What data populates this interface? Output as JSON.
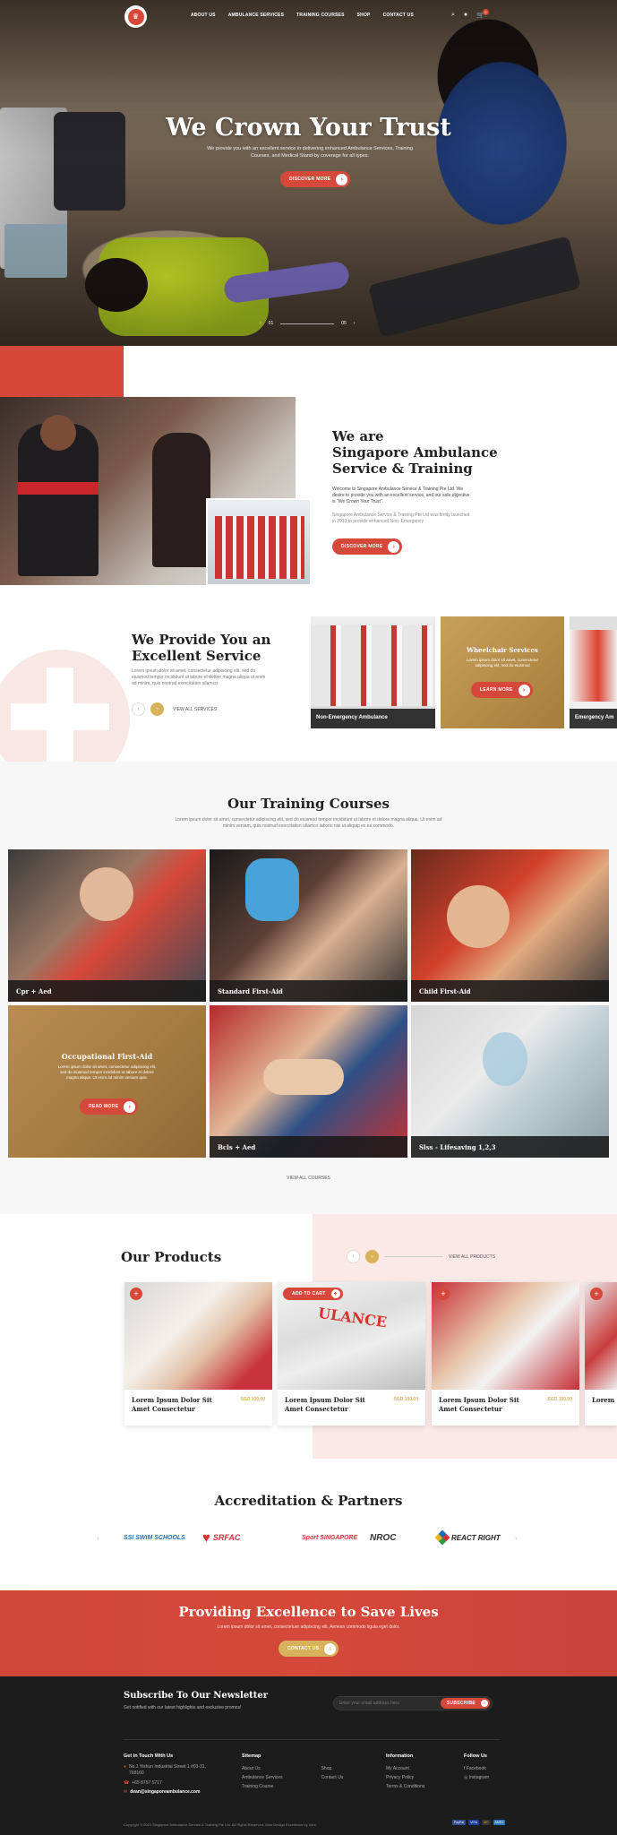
{
  "nav": {
    "items": [
      "ABOUT US",
      "AMBULANCE SERVICES",
      "TRAINING COURSES",
      "SHOP",
      "CONTACT US"
    ],
    "cart_count": "0"
  },
  "hero": {
    "title": "We Crown Your Trust",
    "subtitle": "We provide you with an excellent service in delivering enhanced Ambulance Services, Training Courses, and Medical Stand-by coverage for all types.",
    "button": "DISCOVER MORE",
    "slider": {
      "current": "01",
      "total": "05"
    }
  },
  "about": {
    "title_line1": "We are",
    "title_line2": "Singapore Ambulance",
    "title_line3": "Service & Training",
    "p1": "Welcome to Singapore Ambulance Service & Training Pte Ltd. We desire to provide you with an excellent service, and our sole objective is \"We Crown Your Trust\".",
    "p2": "Singapore Ambulance Service & Training Pte Ltd was firmly launched in 2013 to provide enhanced Non- Emergency",
    "button": "DISCOVER MORE"
  },
  "services": {
    "title_line1": "We Provide You an",
    "title_line2": "Excellent Service",
    "text": "Lorem ipsum dolor sit amet, consectetur adipiscing elit, sed do eiusmod tempor incididunt ut labore et dolore magna aliqua ut enim ad minim, quis nostrud exercitation ullamco",
    "view_all": "VIEW ALL SERVICES",
    "cards": [
      {
        "label": "Non-Emergency Ambulance"
      },
      {
        "label": "Wheelchair Services",
        "text": "Lorem ipsum dolor sit amet, consectetur adipiscing elit, sed do eiusmod",
        "button": "LEARN MORE"
      },
      {
        "label": "Emergency Am"
      }
    ]
  },
  "training": {
    "title": "Our Training Courses",
    "text": "Lorem ipsum dolor sit amet, consectetur adipiscing elit, sed do eiusmod tempor incididunt ut labore et dolore magna aliqua. Ut enim ad minim veniam, quis nostrud exercitation ullamco laboris nisi ut aliquip ex ea commodo.",
    "courses": [
      {
        "label": "Cpr + Aed"
      },
      {
        "label": "Standard First-Aid"
      },
      {
        "label": "Child First-Aid"
      },
      {
        "label": "Occupational First-Aid",
        "text": "Lorem ipsum dolor sit amet, consectetur adipiscing elit, sed do eiusmod tempor incididunt ut labore et dolore magna aliqua. Ut enim ad minim veniam quis.",
        "button": "READ MORE"
      },
      {
        "label": "Bcls + Aed"
      },
      {
        "label": "Slss - Lifesaving 1,2,3"
      }
    ],
    "view_all": "VIEW ALL COURSES"
  },
  "products": {
    "title": "Our Products",
    "view_all": "VIEW ALL PRODUCTS",
    "add_to_cart": "ADD TO CART",
    "items": [
      {
        "title": "Lorem Ipsum Dolor Sit Amet Consectetur",
        "price": "SGD 100.00"
      },
      {
        "title": "Lorem Ipsum Dolor Sit Amet Consectetur",
        "price": "SGD 100.00"
      },
      {
        "title": "Lorem Ipsum Dolor Sit Amet Consectetur",
        "price": "SGD 100.00"
      },
      {
        "title": "Lorem Ipsum Dolor Sit Am",
        "price": ""
      }
    ]
  },
  "partners": {
    "title": "Accreditation & Partners",
    "logos": [
      "SSI SWIM SCHOOLS",
      "SRFAC",
      "Sport SINGAPORE",
      "NROC",
      "REACT RIGHT"
    ]
  },
  "cta": {
    "title": "Providing Excellence to Save Lives",
    "text": "Lorem ipsum dolor sit amet, consectetuer adipiscing elit. Aenean commodo ligula eget dolor.",
    "button": "CONTACT US"
  },
  "newsletter": {
    "title": "Subscribe To Our Newsletter",
    "text": "Get notified with our latest highlights and exclusive promos!",
    "placeholder": "Enter your email address here",
    "button": "SUBSCRIBE"
  },
  "footer": {
    "contact_title": "Get In Touch With Us",
    "address": "No.1 Yishun Industrial Street 1 #03-31, 768160",
    "phone": "+65 8757 5717",
    "email": "dean@singaporeambulance.com",
    "sitemap_title": "Sitemap",
    "sitemap": [
      "About Us",
      "Ambulance Services",
      "Training Course",
      "Shop",
      "Contact Us"
    ],
    "info_title": "Information",
    "info": [
      "My Account",
      "Privacy Policy",
      "Terms & Conditions"
    ],
    "follow_title": "Follow Us",
    "follow": [
      "Facebook",
      "Instagram"
    ],
    "copyright": "Copyright © 2021 Singapore Ambulance Service & Training Pte Ltd. All Rights Reserved. Web Design Excellence by Verz",
    "payments": [
      "PayPal",
      "VISA",
      "MC",
      "AMEX"
    ]
  },
  "colors": {
    "accent": "#d5483a",
    "gold": "#d8b25a",
    "dark": "#1c1c1c"
  }
}
